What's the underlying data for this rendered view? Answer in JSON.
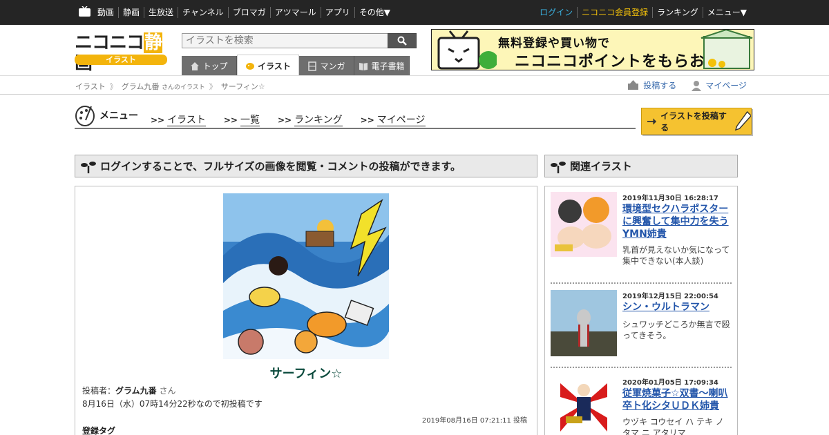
{
  "topbar": {
    "nav": [
      "動画",
      "静画",
      "生放送",
      "チャンネル",
      "ブロマガ",
      "アツマール",
      "アプリ",
      "その他▼"
    ],
    "login": "ログイン",
    "register": "ニコニコ会員登録",
    "ranking": "ランキング",
    "menu": "メニュー▼"
  },
  "header": {
    "logo_main": "ニコニコ",
    "logo_highlight": "静",
    "logo_end": "画",
    "logo_sub": "イラスト",
    "search_placeholder": "イラストを検索",
    "tabs": [
      "トップ",
      "イラスト",
      "マンガ",
      "電子書籍"
    ],
    "banner_line1": "無料登録や買い物で",
    "banner_line2": "ニコニコポイントをもらおう"
  },
  "breadcrumb": {
    "root": "イラスト",
    "author": "グラム九番",
    "author_suffix": "さんのイラスト",
    "current": "サーフィン☆",
    "post_label": "投稿する",
    "mypage_label": "マイページ"
  },
  "menu": {
    "title": "メニュー",
    "links": [
      "イラスト",
      "一覧",
      "ランキング",
      "マイページ"
    ],
    "post_button": "イラストを投稿する"
  },
  "main": {
    "notice": "ログインすることで、フルサイズの画像を閲覧・コメントの投稿ができます。",
    "title": "サーフィン☆",
    "poster_label": "投稿者：",
    "poster": "グラム九番",
    "poster_suffix": "さん",
    "caption": "8月16日（水）07時14分22秒なので初投稿です",
    "posted_at": "2019年08月16日 07:21:11 投稿",
    "tags_heading": "登録タグ"
  },
  "side": {
    "heading": "関連イラスト",
    "items": [
      {
        "date": "2019年11月30日 16:28:17",
        "title": "環境型セクハラポスターに興奮して集中力を失うYMN姉貴",
        "desc": "乳首が見えないか気になって集中できない(本人談)"
      },
      {
        "date": "2019年12月15日 22:00:54",
        "title": "シン・ウルトラマン",
        "desc": "シュワッチどころか無言で殴ってきそう。"
      },
      {
        "date": "2020年01月05日 17:09:34",
        "title": "従軍焼菓子☆双書～喇叭卒ト化シタＵＤＫ姉貴",
        "desc": "ウヅキ コウセイ ハ テキ ノ タマ ニ アタリマ"
      }
    ]
  },
  "colors": {
    "topbar": "#252525",
    "accent_blue": "#3ab1e0",
    "accent_yellow": "#f3c10a",
    "link": "#2255aa",
    "title_green": "#0a4a3c"
  }
}
